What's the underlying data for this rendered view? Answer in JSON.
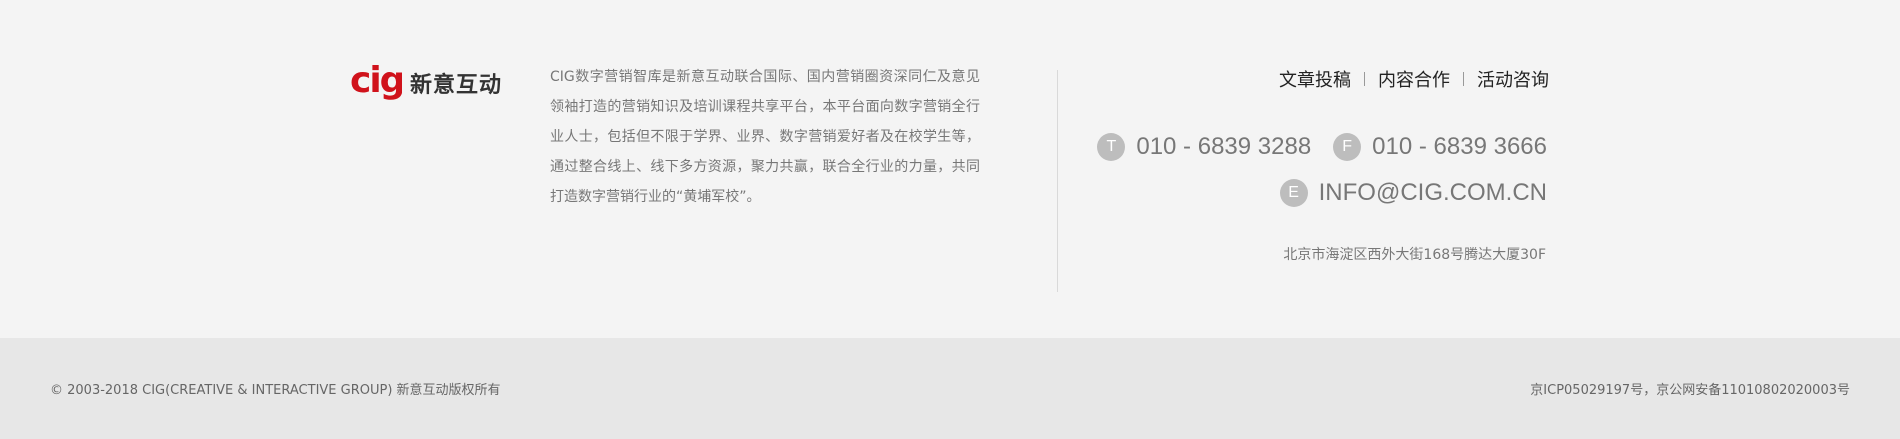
{
  "brand": {
    "logo_mark_text": "cig",
    "name": "新意互动",
    "accent_color": "#d0121b"
  },
  "description": "CIG数字营销智库是新意互动联合国际、国内营销圈资深同仁及意见领袖打造的营销知识及培训课程共享平台，本平台面向数字营销全行业人士，包括但不限于学界、业界、数字营销爱好者及在校学生等，通过整合线上、线下多方资源，聚力共赢，联合全行业的力量，共同打造数字营销行业的“黄埔军校”。",
  "nav": {
    "items": [
      "文章投稿",
      "内容合作",
      "活动咨询"
    ]
  },
  "contact": {
    "phone_badge": "T",
    "phone": "010 - 6839 3288",
    "fax_badge": "F",
    "fax": "010 - 6839 3666",
    "email_badge": "E",
    "email": "INFO@CIG.COM.CN",
    "address": "北京市海淀区西外大街168号腾达大厦30F"
  },
  "legal": {
    "copyright": "© 2003-2018 CIG(CREATIVE & INTERACTIVE GROUP) 新意互动版权所有",
    "icp": "京ICP05029197号，京公网安备11010802020003号"
  }
}
